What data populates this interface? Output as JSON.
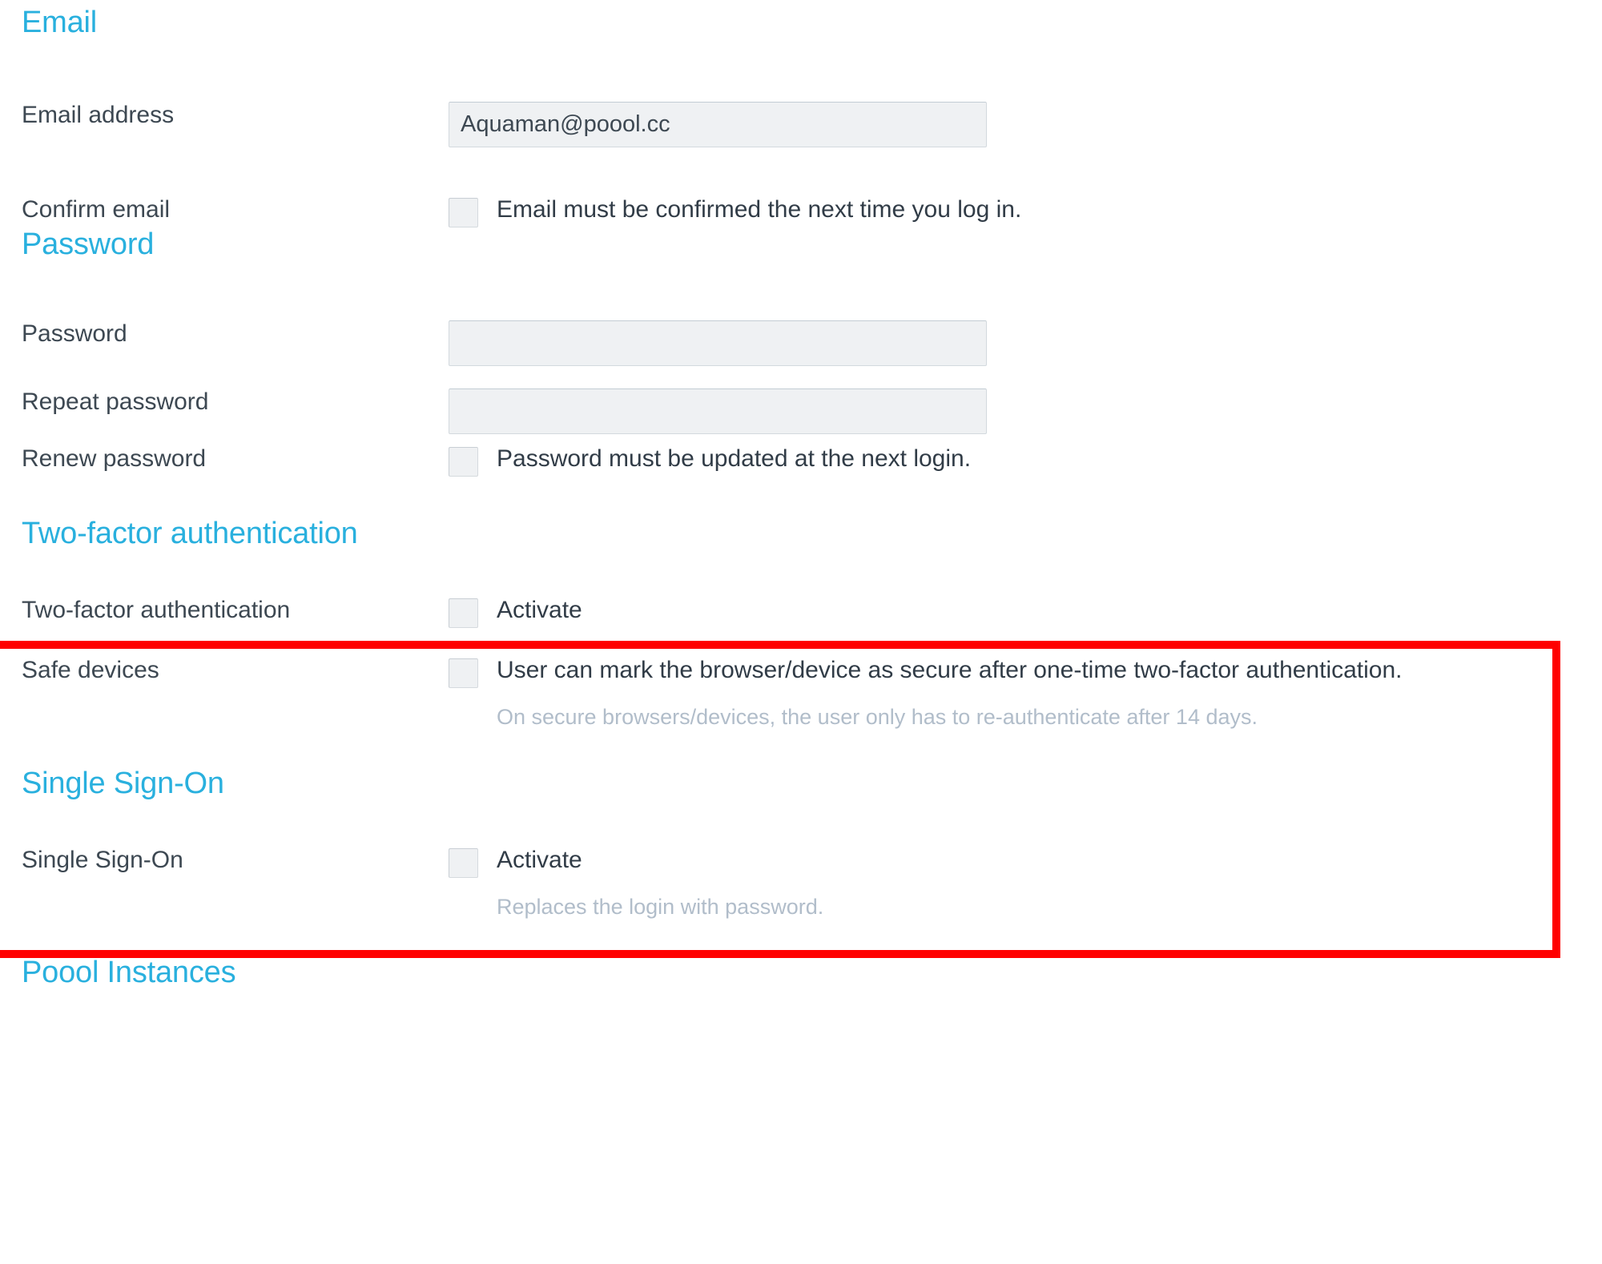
{
  "theme": {
    "heading_color": "#29b0de",
    "body_text_color": "#3d4852",
    "hint_text_color": "#b1bdca",
    "input_background": "#eff1f3",
    "highlight_border_color": "#ff0000"
  },
  "sections": {
    "email": {
      "heading": "Email",
      "rows": {
        "email_address": {
          "label": "Email address",
          "value": "Aquaman@poool.cc",
          "placeholder": ""
        },
        "confirm_email": {
          "label": "Confirm email",
          "checkbox_label": "Email must be confirmed the next time you log in.",
          "checked": false
        }
      }
    },
    "password": {
      "heading": "Password",
      "rows": {
        "password": {
          "label": "Password",
          "value": "",
          "placeholder": ""
        },
        "repeat_password": {
          "label": "Repeat password",
          "value": "",
          "placeholder": ""
        },
        "renew_password": {
          "label": "Renew password",
          "checkbox_label": "Password must be updated at the next login.",
          "checked": false
        }
      }
    },
    "two_factor": {
      "heading": "Two-factor authentication",
      "highlighted": true,
      "rows": {
        "two_factor": {
          "label": "Two-factor authentication",
          "checkbox_label": "Activate",
          "checked": false
        },
        "safe_devices": {
          "label": "Safe devices",
          "checkbox_label": "User can mark the browser/device as secure after one-time two-factor authentication.",
          "hint": "On secure browsers/devices, the user only has to re-authenticate after 14 days.",
          "checked": false
        }
      }
    },
    "single_sign_on": {
      "heading": "Single Sign-On",
      "rows": {
        "single_sign_on": {
          "label": "Single Sign-On",
          "checkbox_label": "Activate",
          "hint": "Replaces the login with password.",
          "checked": false
        }
      }
    },
    "poool_instances": {
      "heading": "Poool Instances"
    }
  }
}
